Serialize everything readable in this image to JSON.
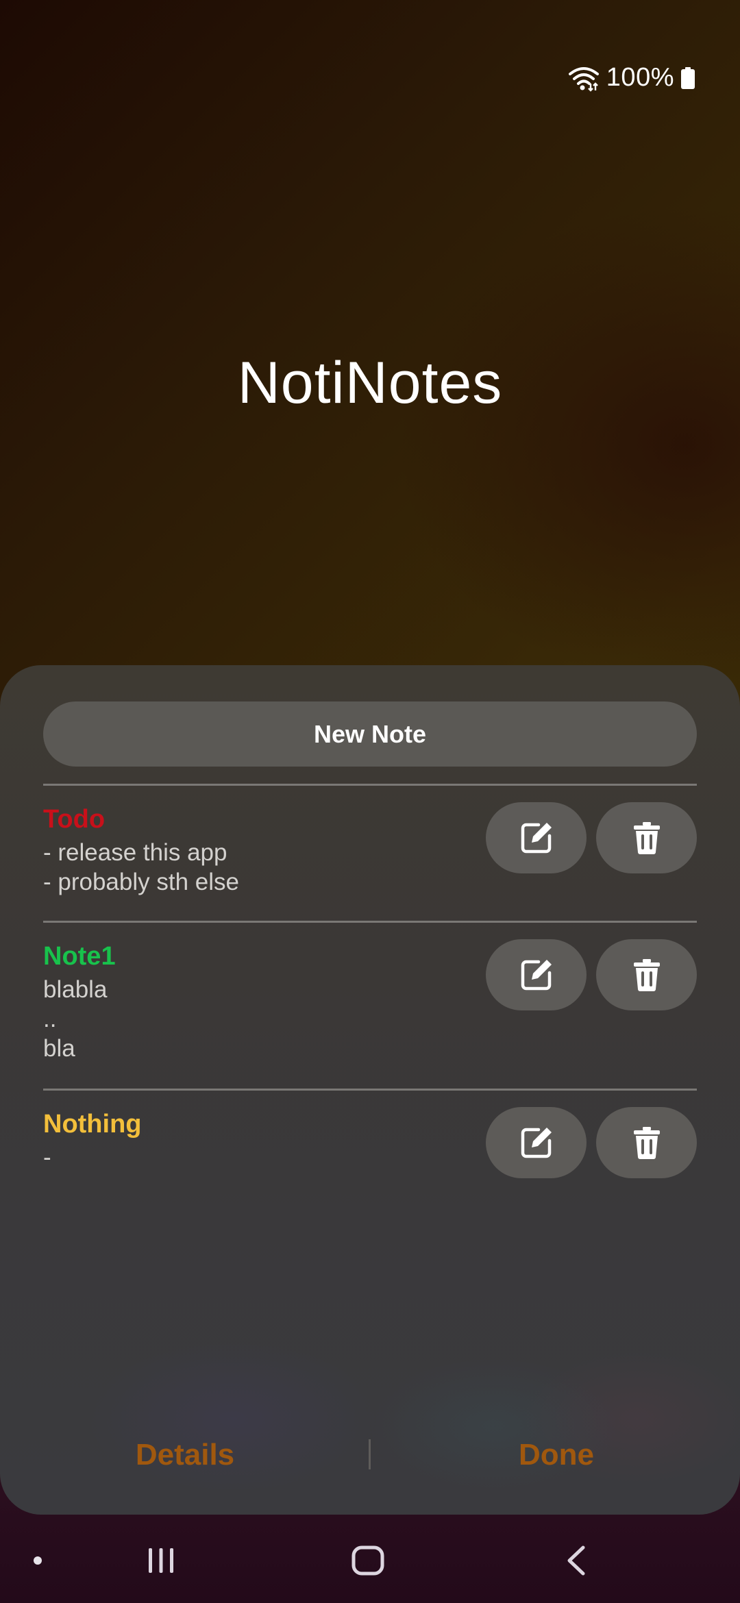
{
  "status_bar": {
    "battery_text": "100%",
    "icons": [
      "wifi-icon",
      "battery-icon"
    ]
  },
  "app": {
    "title": "NotiNotes"
  },
  "sheet": {
    "new_note_label": "New Note",
    "notes": [
      {
        "title": "Todo",
        "title_color": "#c8101a",
        "body": "- release this app\n- probably sth else"
      },
      {
        "title": "Note1",
        "title_color": "#18c24c",
        "body": "blabla\n..\nbla"
      },
      {
        "title": "Nothing",
        "title_color": "#f3bf3b",
        "body": "-"
      }
    ],
    "actions": {
      "edit_icon": "edit-icon",
      "delete_icon": "trash-icon"
    },
    "footer": {
      "details_label": "Details",
      "done_label": "Done",
      "accent_color": "#a0580e"
    }
  },
  "nav_bar": {
    "items": [
      "dot-icon",
      "recents-icon",
      "home-icon",
      "back-icon"
    ]
  }
}
